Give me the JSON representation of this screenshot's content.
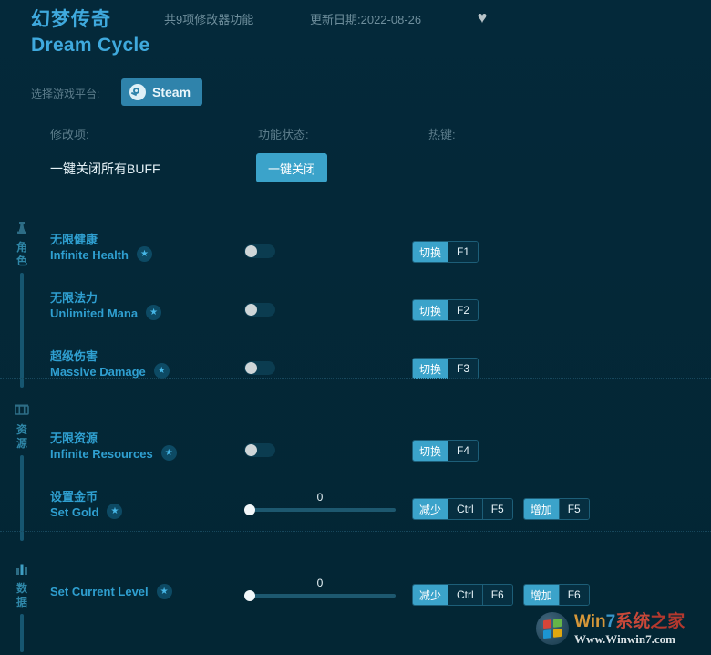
{
  "header": {
    "title_cn": "幻梦传奇",
    "title_en": "Dream Cycle",
    "feature_count": "共9项修改器功能",
    "update_date": "更新日期:2022-08-26",
    "favorite_icon": "♥"
  },
  "platform": {
    "label": "选择游戏平台:",
    "selected": "Steam",
    "icon": "steam-icon"
  },
  "columns": {
    "mod": "修改项:",
    "state": "功能状态:",
    "hotkey": "热键:"
  },
  "master": {
    "label": "一键关闭所有BUFF",
    "button": "一键关闭"
  },
  "sections": [
    {
      "name": "角色",
      "icon": "character-icon",
      "rows": [
        {
          "name_cn": "无限健康",
          "name_en": "Infinite Health",
          "badge": "★",
          "control": "toggle",
          "toggle_on": false,
          "hotkeys": [
            {
              "action": "切换",
              "keys": [
                "F1"
              ]
            }
          ]
        },
        {
          "name_cn": "无限法力",
          "name_en": "Unlimited Mana",
          "badge": "★",
          "control": "toggle",
          "toggle_on": false,
          "hotkeys": [
            {
              "action": "切换",
              "keys": [
                "F2"
              ]
            }
          ]
        },
        {
          "name_cn": "超级伤害",
          "name_en": "Massive Damage",
          "badge": "★",
          "control": "toggle",
          "toggle_on": false,
          "hotkeys": [
            {
              "action": "切换",
              "keys": [
                "F3"
              ]
            }
          ]
        }
      ]
    },
    {
      "name": "资源",
      "icon": "resources-icon",
      "rows": [
        {
          "name_cn": "无限资源",
          "name_en": "Infinite Resources",
          "badge": "★",
          "control": "toggle",
          "toggle_on": false,
          "hotkeys": [
            {
              "action": "切换",
              "keys": [
                "F4"
              ]
            }
          ]
        },
        {
          "name_cn": "设置金币",
          "name_en": "Set Gold",
          "badge": "★",
          "control": "slider",
          "value": "0",
          "hotkeys": [
            {
              "action": "减少",
              "keys": [
                "Ctrl",
                "F5"
              ]
            },
            {
              "action": "增加",
              "keys": [
                "F5"
              ]
            }
          ]
        }
      ]
    },
    {
      "name": "数据",
      "icon": "data-icon",
      "rows": [
        {
          "name_cn": "",
          "name_en": "Set Current Level",
          "badge": "★",
          "control": "slider",
          "value": "0",
          "hotkeys": [
            {
              "action": "减少",
              "keys": [
                "Ctrl",
                "F6"
              ]
            },
            {
              "action": "增加",
              "keys": [
                "F6"
              ]
            }
          ]
        }
      ]
    }
  ],
  "watermark": {
    "part1": "Win",
    "part2": "7",
    "part3": "系统",
    "part4": "之家",
    "url": "Www.Winwin7.com"
  },
  "colors": {
    "background": "#042a3a",
    "accent": "#3ba3ca",
    "title": "#3fa9dd",
    "muted": "#5d7d8c"
  }
}
